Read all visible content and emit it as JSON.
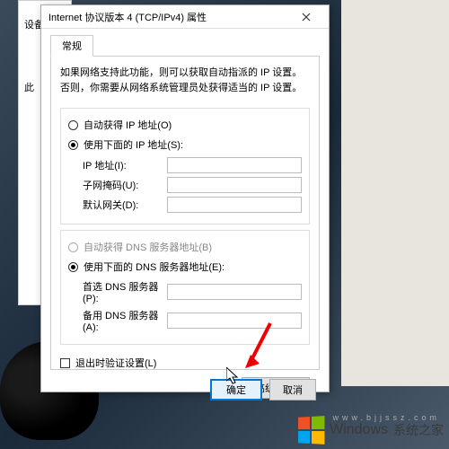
{
  "parent": {
    "label1": "设备",
    "label2": "此"
  },
  "dialog": {
    "title": "Internet 协议版本 4 (TCP/IPv4) 属性",
    "tab": "常规",
    "description": "如果网络支持此功能，则可以获取自动指派的 IP 设置。否则，你需要从网络系统管理员处获得适当的 IP 设置。",
    "ip": {
      "auto": "自动获得 IP 地址(O)",
      "manual": "使用下面的 IP 地址(S):",
      "address_label": "IP 地址(I):",
      "mask_label": "子网掩码(U):",
      "gateway_label": "默认网关(D):",
      "address": "",
      "mask": "",
      "gateway": ""
    },
    "dns": {
      "auto": "自动获得 DNS 服务器地址(B)",
      "manual": "使用下面的 DNS 服务器地址(E):",
      "preferred_label": "首选 DNS 服务器(P):",
      "alternate_label": "备用 DNS 服务器(A):",
      "preferred": "",
      "alternate": ""
    },
    "validate": "退出时验证设置(L)",
    "advanced": "高级(V)...",
    "ok": "确定",
    "cancel": "取消"
  },
  "watermark": {
    "brand": "Windows",
    "sub": "系统之家",
    "url": "www.bjjssz.com"
  }
}
